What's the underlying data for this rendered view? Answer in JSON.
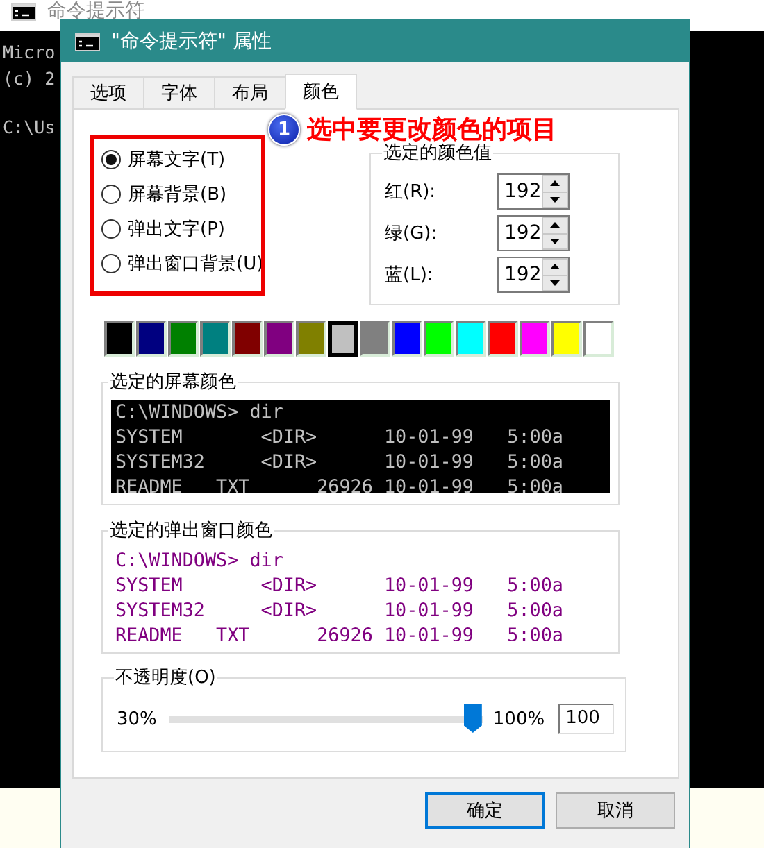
{
  "console_window": {
    "title": "命令提示符",
    "lines": [
      "Micro",
      "(c) 2",
      "C:\\Us"
    ]
  },
  "dialog": {
    "title": "\"命令提示符\" 属性"
  },
  "tabs": [
    {
      "label": "选项",
      "selected": false
    },
    {
      "label": "字体",
      "selected": false
    },
    {
      "label": "布局",
      "selected": false
    },
    {
      "label": "颜色",
      "selected": true
    }
  ],
  "annotation": {
    "number": "1",
    "text": "选中要更改颜色的项目"
  },
  "color_targets": [
    {
      "label": "屏幕文字(T)",
      "selected": true
    },
    {
      "label": "屏幕背景(B)",
      "selected": false
    },
    {
      "label": "弹出文字(P)",
      "selected": false
    },
    {
      "label": "弹出窗口背景(U)",
      "selected": false
    }
  ],
  "color_values": {
    "title": "选定的颜色值",
    "fields": [
      {
        "label": "红(R):",
        "value": "192"
      },
      {
        "label": "绿(G):",
        "value": "192"
      },
      {
        "label": "蓝(L):",
        "value": "192"
      }
    ]
  },
  "palette": [
    {
      "color": "#000000",
      "selected": false
    },
    {
      "color": "#000080",
      "selected": false
    },
    {
      "color": "#008000",
      "selected": false
    },
    {
      "color": "#008080",
      "selected": false
    },
    {
      "color": "#800000",
      "selected": false
    },
    {
      "color": "#800080",
      "selected": false
    },
    {
      "color": "#808000",
      "selected": false
    },
    {
      "color": "#c0c0c0",
      "selected": true
    },
    {
      "color": "#808080",
      "selected": false
    },
    {
      "color": "#0000ff",
      "selected": false
    },
    {
      "color": "#00ff00",
      "selected": false
    },
    {
      "color": "#00ffff",
      "selected": false
    },
    {
      "color": "#ff0000",
      "selected": false
    },
    {
      "color": "#ff00ff",
      "selected": false
    },
    {
      "color": "#ffff00",
      "selected": false
    },
    {
      "color": "#ffffff",
      "selected": false
    }
  ],
  "previews": [
    {
      "title": "选定的屏幕颜色",
      "kind": "screen",
      "lines": [
        "C:\\WINDOWS> dir",
        "SYSTEM       <DIR>      10-01-99   5:00a",
        "SYSTEM32     <DIR>      10-01-99   5:00a",
        "README   TXT      26926 10-01-99   5:00a"
      ]
    },
    {
      "title": "选定的弹出窗口颜色",
      "kind": "popup",
      "lines": [
        "C:\\WINDOWS> dir",
        "SYSTEM       <DIR>      10-01-99   5:00a",
        "SYSTEM32     <DIR>      10-01-99   5:00a",
        "README   TXT      26926 10-01-99   5:00a"
      ]
    }
  ],
  "opacity": {
    "title": "不透明度(O)",
    "min_label": "30%",
    "max_label": "100%",
    "level": 1.0,
    "value": "100"
  },
  "buttons": [
    "确定",
    "取消"
  ]
}
